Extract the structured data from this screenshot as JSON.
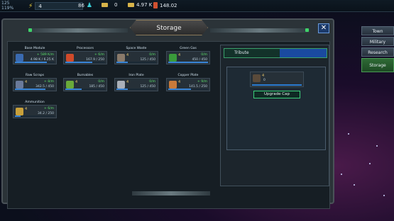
{
  "topbar": {
    "pct_a": "125",
    "pct_b": "119%",
    "energy": "4",
    "population": "86",
    "gold_small": "0",
    "gold": "4.97 K",
    "red": "148.02"
  },
  "menu": {
    "town": "Town",
    "military": "Military",
    "research": "Research",
    "storage": "Storage"
  },
  "panel": {
    "title": "Storage",
    "close": "✕"
  },
  "resources": [
    {
      "label": "Base Module",
      "cap": "",
      "rate": "+ 589 K/m",
      "amount": "4.98 K / 6.25 K",
      "fill": 0.8,
      "color": "#3a6ab0"
    },
    {
      "label": "Processors",
      "cap": "",
      "rate": "+ 6/m",
      "amount": "167.9 / 250",
      "fill": 0.67,
      "color": "#d04a2a"
    },
    {
      "label": "Space Waste",
      "cap": "4",
      "rate": "0/m",
      "amount": "125 / 450",
      "fill": 0.28,
      "color": "#8a7a6a"
    },
    {
      "label": "Green Gas",
      "cap": "4",
      "rate": "0/m",
      "amount": "450 / 450",
      "fill": 1.0,
      "color": "#3a9a3a"
    },
    {
      "label": "Raw Scraps",
      "cap": "4",
      "rate": "+ 8/m",
      "amount": "342.5 / 450",
      "fill": 0.76,
      "color": "#6a7a9a"
    },
    {
      "label": "Burnables",
      "cap": "4",
      "rate": "0/m",
      "amount": "185 / 450",
      "fill": 0.41,
      "color": "#6aaa3a"
    },
    {
      "label": "Iron Plate",
      "cap": "4",
      "rate": "0/m",
      "amount": "125 / 450",
      "fill": 0.28,
      "color": "#aab0b8"
    },
    {
      "label": "Copper Plate",
      "cap": "4",
      "rate": "+ 9/m",
      "amount": "141.5 / 250",
      "fill": 0.57,
      "color": "#c87a3a"
    },
    {
      "label": "Ammunition",
      "cap": "4",
      "rate": "+ 6/m",
      "amount": "34.2 / 250",
      "fill": 0.14,
      "color": "#c8a03a"
    }
  ],
  "tribute": {
    "label": "Tribute",
    "cap": "4",
    "amount": "0",
    "upgrade": "Upgrade Cap"
  }
}
